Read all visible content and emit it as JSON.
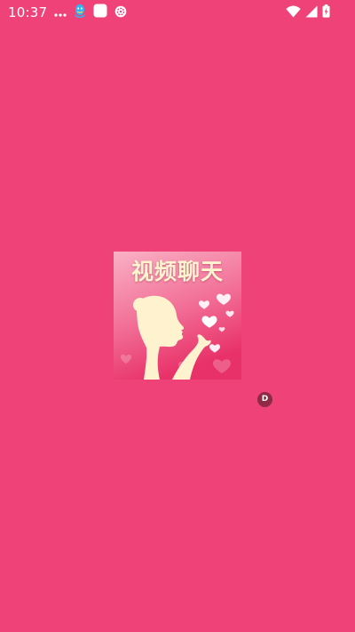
{
  "colors": {
    "background": "#ef4278",
    "status_icons": "#ffffff",
    "logo_bg_top": "#f8a6bf",
    "logo_bg_bottom": "#e9326c",
    "logo_silhouette": "#fff2cf",
    "logo_title": "#fff4cf",
    "badge_bg": "#8e2a45",
    "badge_text": "#ffffff"
  },
  "status_bar": {
    "time": "10:37",
    "left_icons": [
      "more-dots-icon",
      "qq-penguin-icon",
      "white-square-app-icon",
      "notification-badge-icon"
    ],
    "right_icons": [
      "wifi-icon",
      "cell-signal-icon",
      "battery-icon"
    ]
  },
  "splash": {
    "logo_title": "视频聊天",
    "logo_icon": "girl-blowing-kisses-silhouette-icon"
  },
  "floating_badge": {
    "label": "D"
  }
}
